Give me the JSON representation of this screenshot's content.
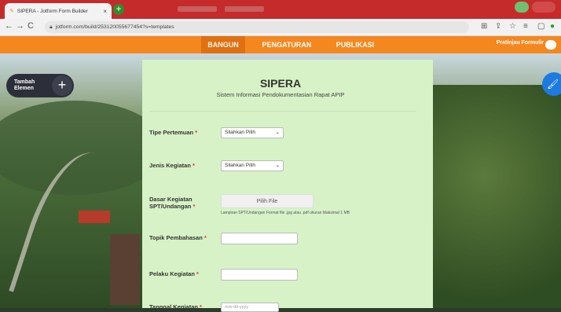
{
  "browser": {
    "tab_title": "SIPERA - Jotform Form Builder",
    "tab_close": "×",
    "new_tab": "+",
    "url": "jotform.com/build/253120055677454?s=templates"
  },
  "nav": {
    "tabs": [
      {
        "label": "BANGUN",
        "active": true
      },
      {
        "label": "PENGATURAN",
        "active": false
      },
      {
        "label": "PUBLIKASI",
        "active": false
      }
    ],
    "preview_label": "Pratinjau Formulir"
  },
  "sidebar": {
    "add_element_label": "Tambah Elemen",
    "plus": "+"
  },
  "form": {
    "title": "SIPERA",
    "subtitle": "Sistem Informasi Pendokumentasian Rapat APIP",
    "fields": {
      "tipe": {
        "label": "Tipe Pertemuan",
        "value": "Silahkan Pilih"
      },
      "jenis": {
        "label": "Jenis Kegiatan",
        "value": "Silahkan Pilih"
      },
      "dasar": {
        "label": "Dasar Kegiatan SPT/Undangan",
        "button": "Pilih File",
        "hint": "Lampiran SPT/Undangan Format file .jpg atau .pdf ukuran Maksimal 1 MB"
      },
      "topik": {
        "label": "Topik Pembahasan"
      },
      "pelaku": {
        "label": "Pelaku Kegiatan"
      },
      "tanggal": {
        "label": "Tanggal Kegiatan",
        "placeholder": "mm-dd-yyyy"
      }
    },
    "required_mark": "*"
  },
  "colors": {
    "brand_orange": "#f5871f",
    "form_bg": "#d7f2c6",
    "chrome_red": "#c52b2b"
  }
}
